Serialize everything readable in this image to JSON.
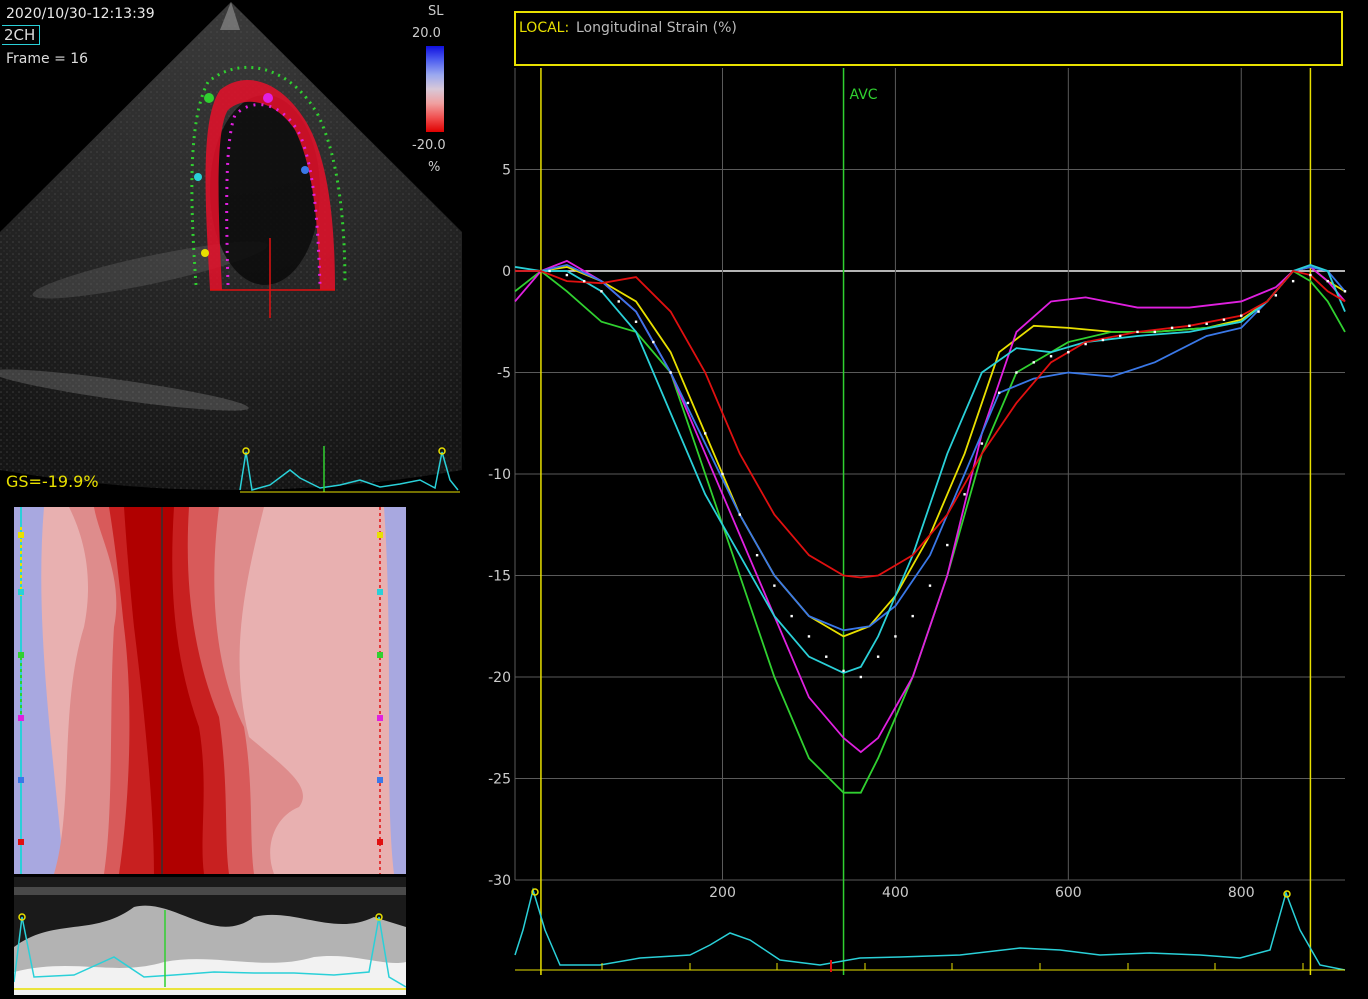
{
  "header": {
    "timestamp": "2020/10/30-12:13:39",
    "view": "2CH",
    "frame": "Frame = 16",
    "global_strain": "GS=-19.9%"
  },
  "colorscale": {
    "title": "SL",
    "max": "20.0",
    "min": "-20.0",
    "unit": "%"
  },
  "colors": {
    "cyan": "#2ad0d8",
    "yellow": "#e8e000",
    "green": "#30d030",
    "magenta": "#e020e0",
    "blue": "#3a78e8",
    "red": "#e01010",
    "grid": "#5a5a5a"
  },
  "chart_data": {
    "type": "line",
    "title_prefix": "LOCAL:",
    "title": "Longitudinal Strain (%)",
    "xlim": [
      -40,
      920
    ],
    "ylim": [
      -30,
      10
    ],
    "x_ticks": [
      200,
      400,
      600,
      800
    ],
    "y_ticks": [
      5,
      0,
      -5,
      -10,
      -15,
      -20,
      -25,
      -30
    ],
    "markers": [
      {
        "label": "AVC",
        "x": 340,
        "color": "#30d030"
      }
    ],
    "cycle_bounds": [
      -10,
      880
    ],
    "series": [
      {
        "color": "#e8e000",
        "x": [
          -40,
          -10,
          20,
          60,
          100,
          140,
          180,
          220,
          260,
          300,
          340,
          370,
          400,
          440,
          480,
          520,
          560,
          600,
          650,
          700,
          760,
          800,
          830,
          860,
          880,
          900,
          920
        ],
        "y": [
          0,
          0,
          0.2,
          -0.5,
          -1.5,
          -4,
          -8,
          -12,
          -15,
          -17,
          -18,
          -17.5,
          -16,
          -13,
          -9,
          -4,
          -2.7,
          -2.8,
          -3,
          -3,
          -2.8,
          -2.4,
          -1.5,
          0,
          0.2,
          -0.5,
          -1
        ]
      },
      {
        "color": "#30d030",
        "x": [
          -40,
          -10,
          20,
          60,
          100,
          140,
          180,
          220,
          260,
          300,
          340,
          360,
          380,
          420,
          460,
          500,
          540,
          600,
          650,
          700,
          760,
          800,
          830,
          860,
          880,
          900,
          920
        ],
        "y": [
          -1,
          0,
          -1,
          -2.5,
          -3,
          -5,
          -10,
          -15,
          -20,
          -24,
          -25.7,
          -25.7,
          -24,
          -20,
          -15,
          -9,
          -5,
          -3.5,
          -3,
          -3,
          -2.8,
          -2.5,
          -1.5,
          0,
          -0.5,
          -1.5,
          -3
        ]
      },
      {
        "color": "#e020e0",
        "x": [
          -40,
          -10,
          20,
          60,
          100,
          140,
          180,
          220,
          260,
          300,
          340,
          360,
          380,
          420,
          460,
          500,
          540,
          580,
          620,
          680,
          740,
          800,
          840,
          860,
          880,
          900,
          920
        ],
        "y": [
          -1.5,
          0,
          0.5,
          -0.5,
          -2,
          -5,
          -9,
          -13,
          -17,
          -21,
          -23,
          -23.7,
          -23,
          -20,
          -15,
          -8,
          -3,
          -1.5,
          -1.3,
          -1.8,
          -1.8,
          -1.5,
          -0.8,
          0,
          0.2,
          -0.5,
          -1.5
        ]
      },
      {
        "color": "#3a78e8",
        "x": [
          -40,
          -10,
          20,
          60,
          100,
          140,
          180,
          220,
          260,
          300,
          340,
          370,
          400,
          440,
          480,
          520,
          560,
          600,
          650,
          700,
          760,
          800,
          830,
          860,
          880,
          900,
          920
        ],
        "y": [
          0,
          0,
          0.3,
          -0.5,
          -2,
          -5,
          -8.5,
          -12,
          -15,
          -17,
          -17.7,
          -17.5,
          -16.5,
          -14,
          -10,
          -6,
          -5.3,
          -5,
          -5.2,
          -4.5,
          -3.2,
          -2.8,
          -1.5,
          0,
          0.2,
          0,
          -1
        ]
      },
      {
        "color": "#2ad0d8",
        "x": [
          -40,
          -10,
          20,
          60,
          100,
          140,
          180,
          220,
          260,
          300,
          340,
          360,
          380,
          420,
          460,
          500,
          540,
          580,
          620,
          680,
          740,
          800,
          830,
          860,
          880,
          900,
          920
        ],
        "y": [
          0.2,
          0,
          0,
          -1,
          -3,
          -7,
          -11,
          -14,
          -17,
          -19,
          -19.8,
          -19.5,
          -18,
          -14,
          -9,
          -5,
          -3.8,
          -4,
          -3.5,
          -3.2,
          -3,
          -2.5,
          -1.5,
          0,
          0.3,
          0,
          -2
        ]
      },
      {
        "color": "#e01010",
        "x": [
          -40,
          -10,
          20,
          60,
          100,
          140,
          180,
          220,
          260,
          300,
          340,
          360,
          380,
          420,
          460,
          500,
          540,
          580,
          620,
          680,
          740,
          800,
          830,
          860,
          880,
          900,
          920
        ],
        "y": [
          0,
          0,
          -0.5,
          -0.6,
          -0.3,
          -2,
          -5,
          -9,
          -12,
          -14,
          -15,
          -15.1,
          -15,
          -14,
          -12,
          -9,
          -6.5,
          -4.5,
          -3.5,
          -3,
          -2.7,
          -2.2,
          -1.5,
          0,
          -0.2,
          -1,
          -1.5
        ]
      }
    ],
    "average_points": {
      "x": [
        0,
        20,
        40,
        60,
        80,
        100,
        120,
        140,
        160,
        180,
        200,
        220,
        240,
        260,
        280,
        300,
        320,
        340,
        360,
        380,
        400,
        420,
        440,
        460,
        480,
        500,
        520,
        540,
        560,
        580,
        600,
        620,
        640,
        660,
        680,
        700,
        720,
        740,
        760,
        780,
        800,
        820,
        840,
        860,
        880,
        900,
        920
      ],
      "y": [
        0,
        -0.2,
        -0.5,
        -1,
        -1.5,
        -2.5,
        -3.5,
        -5,
        -6.5,
        -8,
        -10,
        -12,
        -14,
        -15.5,
        -17,
        -18,
        -19,
        -19.7,
        -20,
        -19,
        -18,
        -17,
        -15.5,
        -13.5,
        -11,
        -8.5,
        -6,
        -5,
        -4.5,
        -4.2,
        -4,
        -3.6,
        -3.4,
        -3.2,
        -3,
        -3,
        -2.8,
        -2.7,
        -2.6,
        -2.4,
        -2.2,
        -2,
        -1.2,
        -0.5,
        -0.2,
        -0.5,
        -1
      ]
    }
  }
}
